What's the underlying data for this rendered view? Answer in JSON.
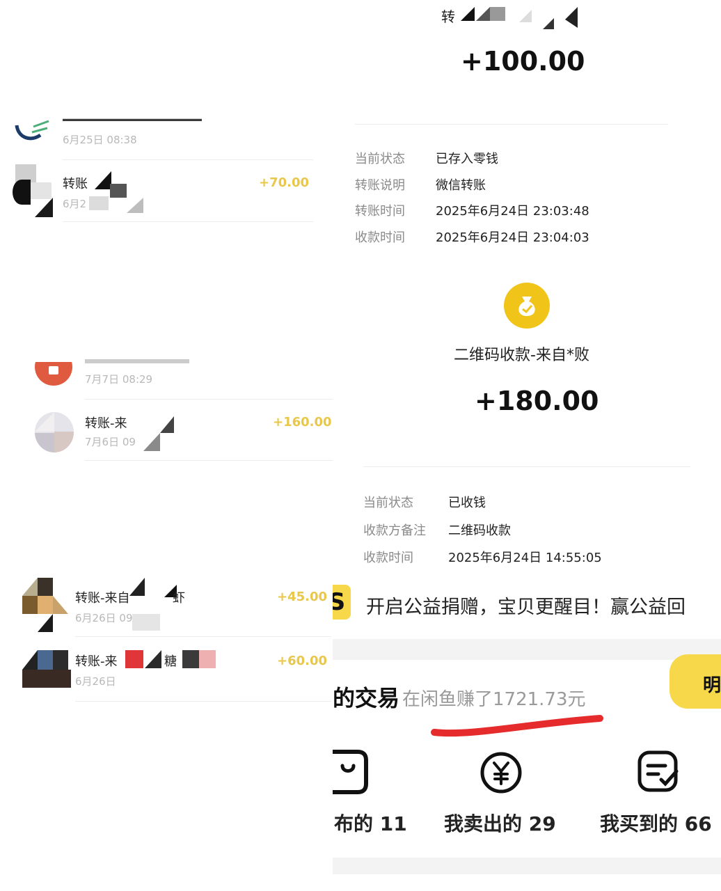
{
  "left": {
    "row1": {
      "date": "6月25日 08:38"
    },
    "row2": {
      "title": "转账",
      "date": "6月2",
      "amount": "+70.00"
    },
    "row3": {
      "date": "7月7日 08:29"
    },
    "row4": {
      "title": "转账-来",
      "date": "7月6日 09",
      "amount": "+160.00"
    },
    "row5": {
      "title": "转账-来自",
      "title_tail": "虾",
      "date": "6月26日 09",
      "amount": "+45.00"
    },
    "row6": {
      "title": "转账-来",
      "title_tail": "糖",
      "date": "6月26日",
      "amount": "+60.00"
    }
  },
  "right_top": {
    "header": "转",
    "amount": "+100.00",
    "rows": [
      {
        "label": "当前状态",
        "value": "已存入零钱"
      },
      {
        "label": "转账说明",
        "value": "微信转账"
      },
      {
        "label": "转账时间",
        "value": "2025年6月24日 23:03:48"
      },
      {
        "label": "收款时间",
        "value": "2025年6月24日 23:04:03"
      }
    ]
  },
  "right_mid": {
    "title": "二维码收款-来自*败",
    "amount": "+180.00",
    "rows": [
      {
        "label": "当前状态",
        "value": "已收钱"
      },
      {
        "label": "收款方备注",
        "value": "二维码收款"
      },
      {
        "label": "收款时间",
        "value": "2025年6月24日 14:55:05"
      }
    ]
  },
  "right_bottom": {
    "banner_icon": "S",
    "banner_text": "开启公益捐赠，宝贝更醒目！赢公益回",
    "trade_title": "的交易",
    "trade_sub": "在闲鱼赚了1721.73元",
    "side_tab": "明",
    "stats": [
      {
        "label": "布的 11",
        "icon": "bag-icon"
      },
      {
        "label": "我卖出的 29",
        "icon": "yen-circle-icon"
      },
      {
        "label": "我买到的 66",
        "icon": "check-note-icon"
      }
    ],
    "colors": {
      "accent_yellow": "#f7d84a",
      "underline_red": "#e52b2b"
    }
  }
}
